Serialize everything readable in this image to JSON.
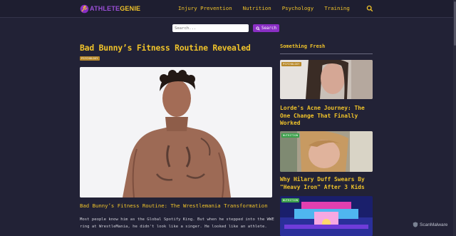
{
  "brand": {
    "part1": "ATHLETE",
    "part2": "GENIE"
  },
  "nav": {
    "items": [
      "Injury Prevention",
      "Nutrition",
      "Psychology",
      "Training"
    ]
  },
  "search": {
    "placeholder": "Search...",
    "button_label": "Search"
  },
  "article": {
    "title": "Bad Bunny’s Fitness Routine Revealed",
    "category": "PSYCHOLOGY",
    "subheading": "Bad Bunny’s Fitness Routine: The Wrestlemania Transformation",
    "body": "Most people know him as the Global Spotify King. But when he stepped into the WWE ring at WrestleMania, he didn't look like a singer. He looked like an athlete."
  },
  "sidebar": {
    "title": "Something Fresh",
    "cards": [
      {
        "category": "PSYCHOLOGY",
        "title": "Lorde's Acne Journey: The One Change That Finally Worked"
      },
      {
        "category": "NUTRITION",
        "title": "Why Hilary Duff Swears By \"Heavy Iron\" After 3 Kids"
      },
      {
        "category": "NUTRITION",
        "title": ""
      }
    ]
  },
  "watermark": "ScanMalware",
  "colors": {
    "background": "#222236",
    "accent": "#f0c32a",
    "purple": "#8a2fc4",
    "psychology_badge": "#b8892a",
    "nutrition_badge": "#3aa04a"
  }
}
